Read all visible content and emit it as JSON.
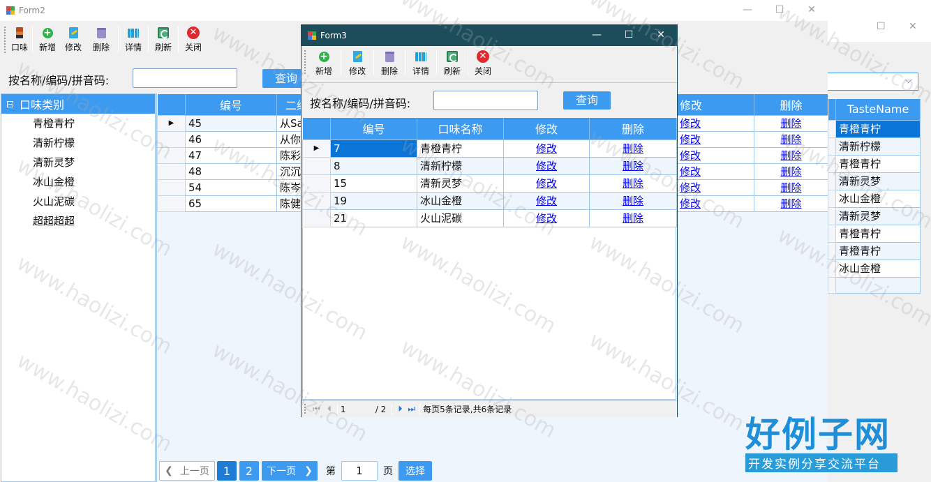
{
  "form2": {
    "title": "Form2",
    "toolbar": [
      "口味",
      "新增",
      "修改",
      "删除",
      "详情",
      "刷新",
      "关闭"
    ],
    "search_label": "按名称/编码/拼音码:",
    "search_value": "",
    "query_label": "查询",
    "tree": {
      "root": "口味类别",
      "items": [
        "青橙青柠",
        "清新柠檬",
        "清新灵梦",
        "冰山金橙",
        "火山泥碳",
        "超超超超"
      ]
    },
    "grid": {
      "headers": [
        "编号",
        "二级",
        "修改",
        "删除"
      ],
      "rows": [
        {
          "id": "45",
          "name": "从Sa",
          "edit": "修改",
          "del": "删除"
        },
        {
          "id": "46",
          "name": "从你",
          "edit": "修改",
          "del": "删除"
        },
        {
          "id": "47",
          "name": "陈彩",
          "edit": "修改",
          "del": "删除"
        },
        {
          "id": "48",
          "name": "沉沉",
          "edit": "修改",
          "del": "删除"
        },
        {
          "id": "54",
          "name": "陈岑",
          "edit": "修改",
          "del": "删除"
        },
        {
          "id": "65",
          "name": "陈健",
          "edit": "修改",
          "del": "删除"
        }
      ]
    },
    "pager": {
      "prev": "上一页",
      "pages": [
        "1",
        "2"
      ],
      "next": "下一页",
      "goto_prefix": "第",
      "goto_value": "1",
      "goto_suffix": "页",
      "select": "选择"
    }
  },
  "back_window": {
    "grid_header": "TasteName",
    "rows": [
      "青橙青柠",
      "清新柠檬",
      "青橙青柠",
      "清新灵梦",
      "冰山金橙",
      "清新灵梦",
      "青橙青柠",
      "青橙青柠",
      "冰山金橙",
      ""
    ]
  },
  "form3": {
    "title": "Form3",
    "toolbar": [
      "新增",
      "修改",
      "删除",
      "详情",
      "刷新",
      "关闭"
    ],
    "search_label": "按名称/编码/拼音码:",
    "search_value": "",
    "query_label": "查询",
    "grid": {
      "headers": [
        "编号",
        "口味名称",
        "修改",
        "删除"
      ],
      "rows": [
        {
          "id": "7",
          "name": "青橙青柠",
          "edit": "修改",
          "del": "删除"
        },
        {
          "id": "8",
          "name": "清新柠檬",
          "edit": "修改",
          "del": "删除"
        },
        {
          "id": "15",
          "name": "清新灵梦",
          "edit": "修改",
          "del": "删除"
        },
        {
          "id": "19",
          "name": "冰山金橙",
          "edit": "修改",
          "del": "删除"
        },
        {
          "id": "21",
          "name": "火山泥碳",
          "edit": "修改",
          "del": "删除"
        }
      ]
    },
    "nav": {
      "current": "1",
      "total": "/ 2",
      "summary": "每页5条记录,共6条记录"
    }
  },
  "watermark": "www.haolizi.com",
  "logo": {
    "main": "好例子网",
    "sub": "开发实例分享交流平台"
  },
  "colors": {
    "accent": "#3c9af0",
    "selected": "#0a75d6",
    "form3_titlebar": "#1d4d5b",
    "link": "#0000ee"
  }
}
